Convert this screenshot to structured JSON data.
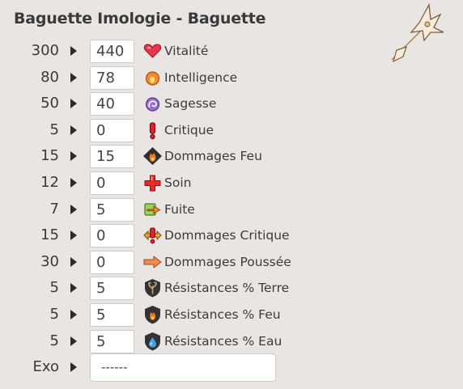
{
  "title": "Baguette Imologie - Baguette",
  "stats": [
    {
      "max": "300",
      "value": "440",
      "label": "Vitalité",
      "icon": "heart-icon"
    },
    {
      "max": "80",
      "value": "78",
      "label": "Intelligence",
      "icon": "fire-orb-icon"
    },
    {
      "max": "50",
      "value": "40",
      "label": "Sagesse",
      "icon": "wisdom-swirl-icon"
    },
    {
      "max": "5",
      "value": "0",
      "label": "Critique",
      "icon": "exclamation-icon"
    },
    {
      "max": "15",
      "value": "15",
      "label": "Dommages Feu",
      "icon": "fire-damage-icon"
    },
    {
      "max": "12",
      "value": "0",
      "label": "Soin",
      "icon": "red-cross-icon"
    },
    {
      "max": "7",
      "value": "5",
      "label": "Fuite",
      "icon": "escape-arrow-icon"
    },
    {
      "max": "15",
      "value": "0",
      "label": "Dommages Critique",
      "icon": "critical-damage-icon"
    },
    {
      "max": "30",
      "value": "0",
      "label": "Dommages Poussée",
      "icon": "push-arrow-icon"
    },
    {
      "max": "5",
      "value": "5",
      "label": "Résistances % Terre",
      "icon": "earth-shield-icon"
    },
    {
      "max": "5",
      "value": "5",
      "label": "Résistances % Feu",
      "icon": "fire-shield-icon"
    },
    {
      "max": "5",
      "value": "5",
      "label": "Résistances % Eau",
      "icon": "water-shield-icon"
    }
  ],
  "exo": {
    "label": "Exo",
    "value": "------"
  }
}
